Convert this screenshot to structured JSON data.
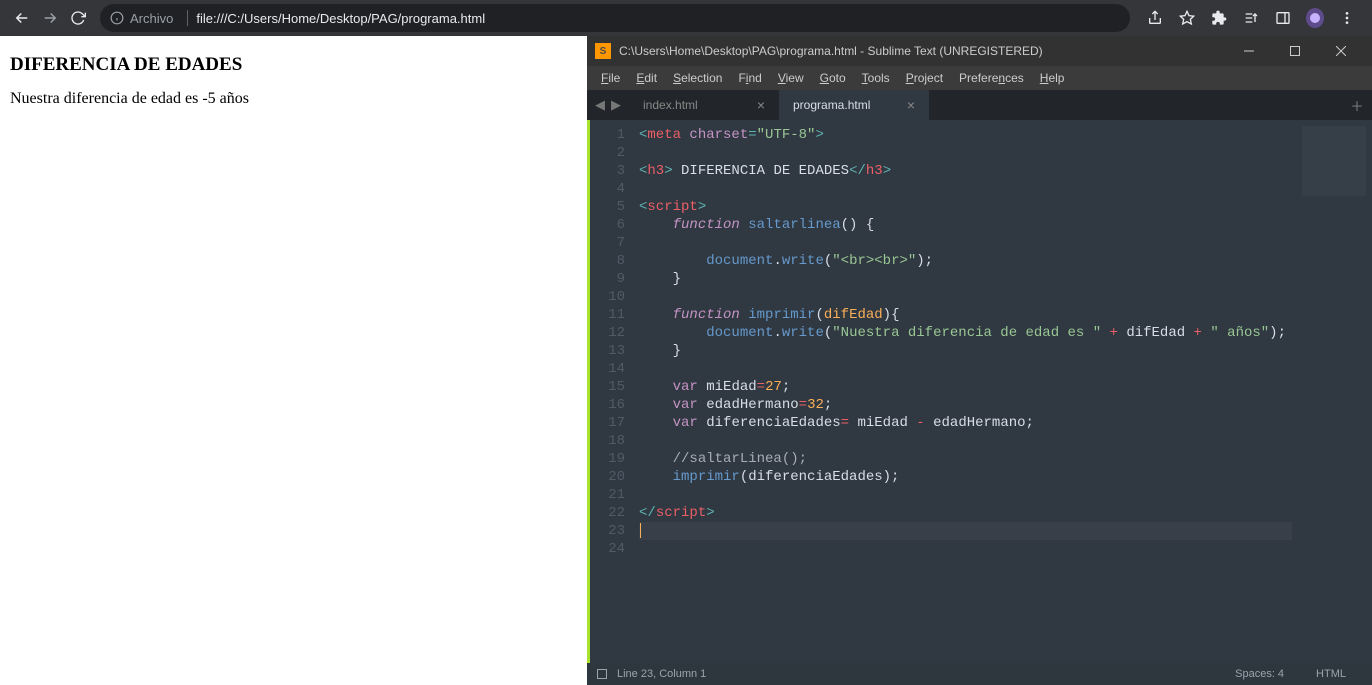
{
  "browser": {
    "addr_label": "Archivo",
    "addr_url": "file:///C:/Users/Home/Desktop/PAG/programa.html",
    "page": {
      "title": "DIFERENCIA DE EDADES",
      "text": "Nuestra diferencia de edad es -5 años"
    }
  },
  "sublime": {
    "title": "C:\\Users\\Home\\Desktop\\PAG\\programa.html - Sublime Text (UNREGISTERED)",
    "menu": [
      "File",
      "Edit",
      "Selection",
      "Find",
      "View",
      "Goto",
      "Tools",
      "Project",
      "Preferences",
      "Help"
    ],
    "tabs": [
      {
        "label": "index.html",
        "active": false
      },
      {
        "label": "programa.html",
        "active": true
      }
    ],
    "gutter_lines": [
      "1",
      "2",
      "3",
      "4",
      "5",
      "6",
      "7",
      "8",
      "9",
      "10",
      "11",
      "12",
      "13",
      "14",
      "15",
      "16",
      "17",
      "18",
      "19",
      "20",
      "21",
      "22",
      "23",
      "24"
    ],
    "status": {
      "pos": "Line 23, Column 1",
      "spaces": "Spaces: 4",
      "syntax": "HTML"
    },
    "code": {
      "miEdad": 27,
      "edadHermano": 32,
      "h3_text": " DIFERENCIA DE EDADES",
      "print_prefix": "\"Nuestra diferencia de edad es \"",
      "print_suffix": "\" años\"",
      "br_str": "\"<br><br>\""
    }
  }
}
